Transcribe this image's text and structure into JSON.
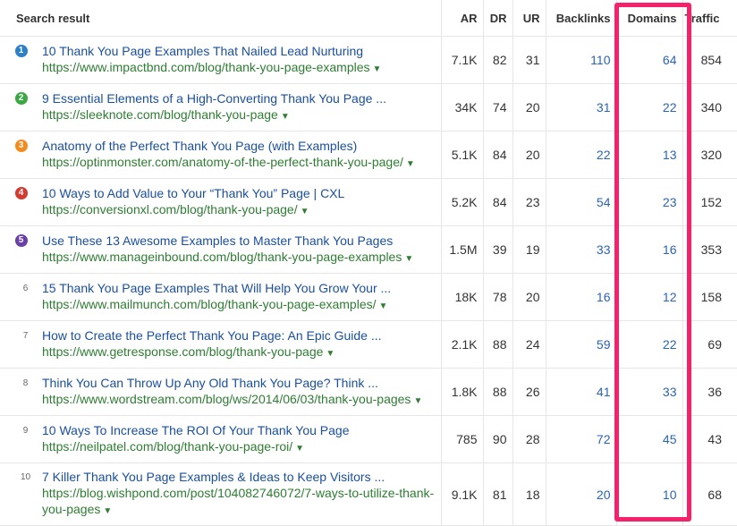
{
  "headers": {
    "result": "Search result",
    "ar": "AR",
    "dr": "DR",
    "ur": "UR",
    "backlinks": "Backlinks",
    "domains": "Domains",
    "traffic": "Traffic"
  },
  "rows": [
    {
      "rank": "1",
      "badge_color": "#2d7fc7",
      "title": "10 Thank You Page Examples That Nailed Lead Nurturing",
      "url": "https://www.impactbnd.com/blog/thank-you-page-examples",
      "ar": "7.1K",
      "dr": "82",
      "ur": "31",
      "backlinks": "110",
      "domains": "64",
      "traffic": "854"
    },
    {
      "rank": "2",
      "badge_color": "#3aa843",
      "title": "9 Essential Elements of a High-Converting Thank You Page ...",
      "url": "https://sleeknote.com/blog/thank-you-page",
      "ar": "34K",
      "dr": "74",
      "ur": "20",
      "backlinks": "31",
      "domains": "22",
      "traffic": "340"
    },
    {
      "rank": "3",
      "badge_color": "#f48b1e",
      "title": "Anatomy of the Perfect Thank You Page (with Examples)",
      "url": "https://optinmonster.com/anatomy-of-the-perfect-thank-you-page/",
      "ar": "5.1K",
      "dr": "84",
      "ur": "20",
      "backlinks": "22",
      "domains": "13",
      "traffic": "320"
    },
    {
      "rank": "4",
      "badge_color": "#d33b32",
      "title": "10 Ways to Add Value to Your “Thank You” Page | CXL",
      "url": "https://conversionxl.com/blog/thank-you-page/",
      "ar": "5.2K",
      "dr": "84",
      "ur": "23",
      "backlinks": "54",
      "domains": "23",
      "traffic": "152"
    },
    {
      "rank": "5",
      "badge_color": "#6b3fa8",
      "title": "Use These 13 Awesome Examples to Master Thank You Pages",
      "url": "https://www.manageinbound.com/blog/thank-you-page-examples",
      "ar": "1.5M",
      "dr": "39",
      "ur": "19",
      "backlinks": "33",
      "domains": "16",
      "traffic": "353"
    },
    {
      "rank": "6",
      "badge_color": "",
      "title": "15 Thank You Page Examples That Will Help You Grow Your ...",
      "url": "https://www.mailmunch.com/blog/thank-you-page-examples/",
      "ar": "18K",
      "dr": "78",
      "ur": "20",
      "backlinks": "16",
      "domains": "12",
      "traffic": "158"
    },
    {
      "rank": "7",
      "badge_color": "",
      "title": "How to Create the Perfect Thank You Page: An Epic Guide ...",
      "url": "https://www.getresponse.com/blog/thank-you-page",
      "ar": "2.1K",
      "dr": "88",
      "ur": "24",
      "backlinks": "59",
      "domains": "22",
      "traffic": "69"
    },
    {
      "rank": "8",
      "badge_color": "",
      "title": "Think You Can Throw Up Any Old Thank You Page? Think ...",
      "url": "https://www.wordstream.com/blog/ws/2014/06/03/thank-you-pages",
      "ar": "1.8K",
      "dr": "88",
      "ur": "26",
      "backlinks": "41",
      "domains": "33",
      "traffic": "36"
    },
    {
      "rank": "9",
      "badge_color": "",
      "title": "10 Ways To Increase The ROI Of Your Thank You Page",
      "url": "https://neilpatel.com/blog/thank-you-page-roi/",
      "ar": "785",
      "dr": "90",
      "ur": "28",
      "backlinks": "72",
      "domains": "45",
      "traffic": "43"
    },
    {
      "rank": "10",
      "badge_color": "",
      "title": "7 Killer Thank You Page Examples & Ideas to Keep Visitors ...",
      "url": "https://blog.wishpond.com/post/104082746072/7-ways-to-utilize-thank-you-pages",
      "ar": "9.1K",
      "dr": "81",
      "ur": "18",
      "backlinks": "20",
      "domains": "10",
      "traffic": "68"
    }
  ],
  "highlight_color": "#f5216b",
  "dropdown_icon": "caret-down-icon"
}
